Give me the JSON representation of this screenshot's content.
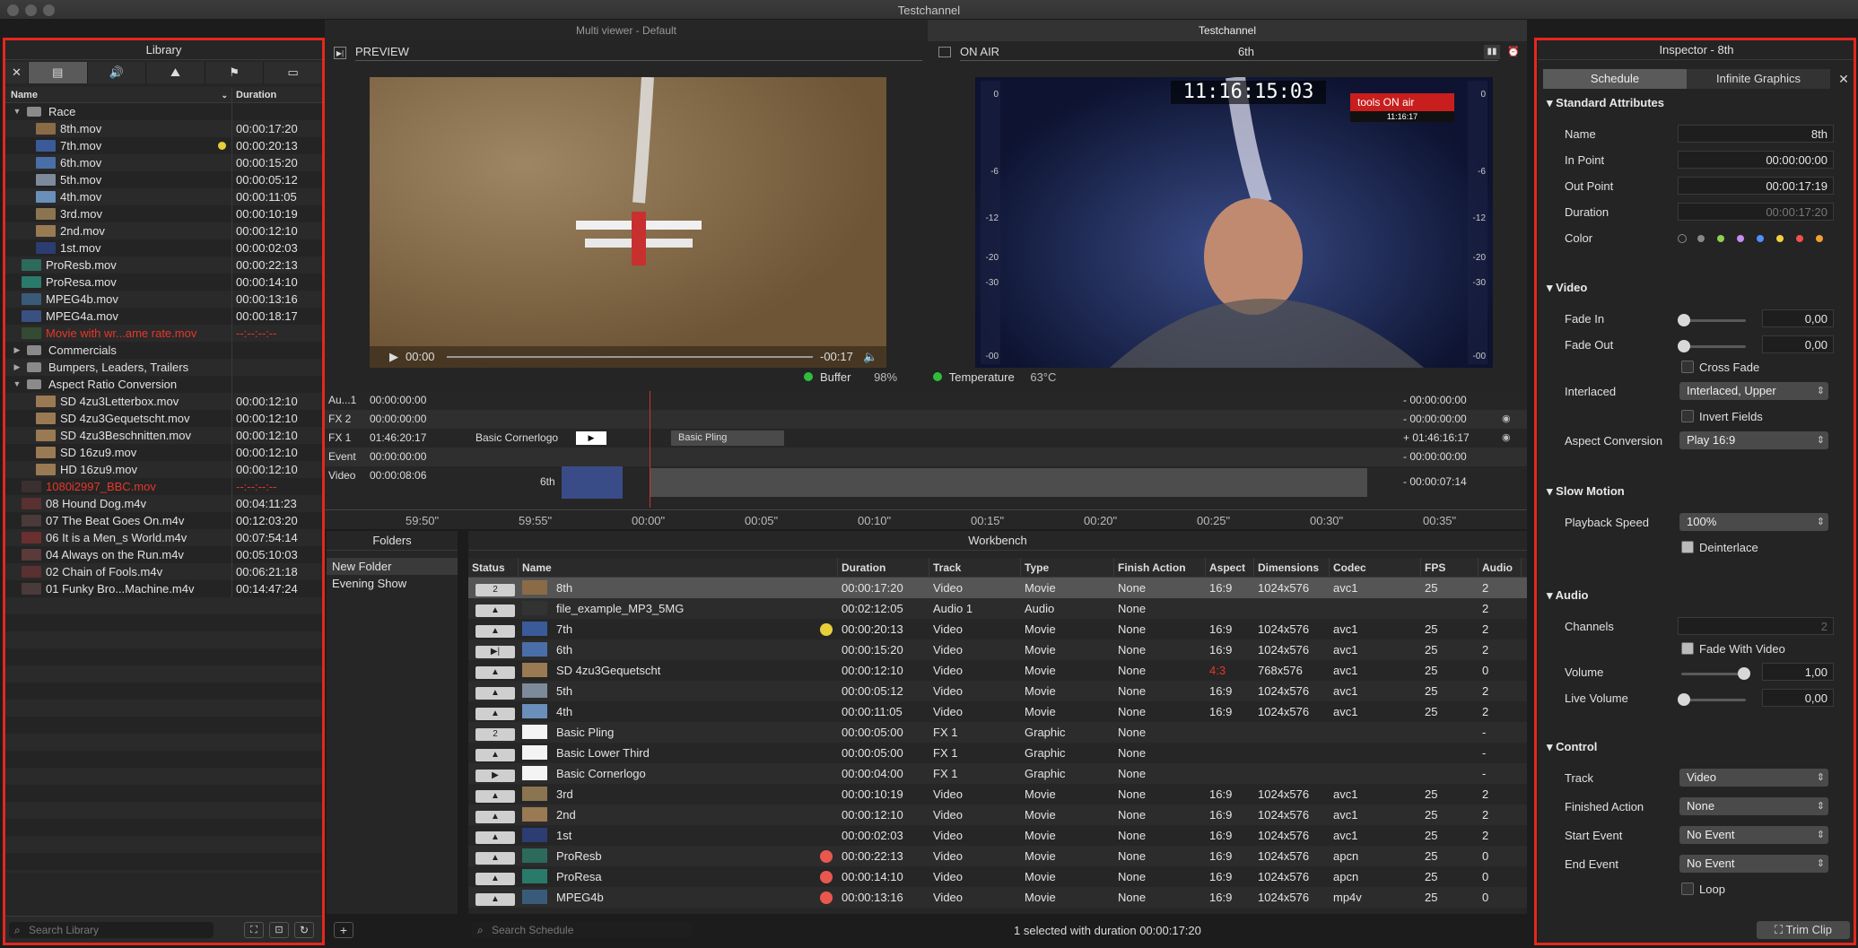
{
  "window": {
    "title": "Testchannel"
  },
  "tabs": [
    {
      "label": "Multi viewer - Default"
    },
    {
      "label": "Testchannel"
    }
  ],
  "library": {
    "title": "Library",
    "filters": [
      "✕",
      "▤",
      "🔊",
      "⛰",
      "⚑",
      "▭"
    ],
    "col_name": "Name",
    "col_duration": "Duration",
    "items": [
      {
        "name": "Race",
        "duration": "",
        "kind": "folder",
        "open": true,
        "indent": 0
      },
      {
        "name": "8th.mov",
        "duration": "00:00:17:20",
        "indent": 1,
        "thumb": "#8a6b45"
      },
      {
        "name": "7th.mov",
        "duration": "00:00:20:13",
        "indent": 1,
        "thumb": "#3b5a9a",
        "dot": true
      },
      {
        "name": "6th.mov",
        "duration": "00:00:15:20",
        "indent": 1,
        "thumb": "#4a6fa8"
      },
      {
        "name": "5th.mov",
        "duration": "00:00:05:12",
        "indent": 1,
        "thumb": "#7d8a9a"
      },
      {
        "name": "4th.mov",
        "duration": "00:00:11:05",
        "indent": 1,
        "thumb": "#6a8fba"
      },
      {
        "name": "3rd.mov",
        "duration": "00:00:10:19",
        "indent": 1,
        "thumb": "#8b7550"
      },
      {
        "name": "2nd.mov",
        "duration": "00:00:12:10",
        "indent": 1,
        "thumb": "#9a7a52"
      },
      {
        "name": "1st.mov",
        "duration": "00:00:02:03",
        "indent": 1,
        "thumb": "#2c3d72"
      },
      {
        "name": "ProResb.mov",
        "duration": "00:00:22:13",
        "indent": 0,
        "thumb": "#2c6a5c"
      },
      {
        "name": "ProResa.mov",
        "duration": "00:00:14:10",
        "indent": 0,
        "thumb": "#2a7a6a"
      },
      {
        "name": "MPEG4b.mov",
        "duration": "00:00:13:16",
        "indent": 0,
        "thumb": "#3a5a7a"
      },
      {
        "name": "MPEG4a.mov",
        "duration": "00:00:18:17",
        "indent": 0,
        "thumb": "#3a5080"
      },
      {
        "name": "Movie with wr...ame rate.mov",
        "duration": "--:--:--:--",
        "indent": 0,
        "thumb": "#334a33",
        "red": true
      },
      {
        "name": "Commercials",
        "duration": "",
        "kind": "folder",
        "open": false,
        "indent": 0
      },
      {
        "name": "Bumpers, Leaders, Trailers",
        "duration": "",
        "kind": "folder",
        "open": false,
        "indent": 0
      },
      {
        "name": "Aspect Ratio Conversion",
        "duration": "",
        "kind": "folder",
        "open": true,
        "indent": 0
      },
      {
        "name": "SD 4zu3Letterbox.mov",
        "duration": "00:00:12:10",
        "indent": 1,
        "thumb": "#9a7a52"
      },
      {
        "name": "SD 4zu3Gequetscht.mov",
        "duration": "00:00:12:10",
        "indent": 1,
        "thumb": "#9a7a52"
      },
      {
        "name": "SD 4zu3Beschnitten.mov",
        "duration": "00:00:12:10",
        "indent": 1,
        "thumb": "#9a7a52"
      },
      {
        "name": "SD 16zu9.mov",
        "duration": "00:00:12:10",
        "indent": 1,
        "thumb": "#9a7a52"
      },
      {
        "name": "HD 16zu9.mov",
        "duration": "00:00:12:10",
        "indent": 1,
        "thumb": "#9a7a52"
      },
      {
        "name": "1080i2997_BBC.mov",
        "duration": "--:--:--:--",
        "indent": 0,
        "thumb": "#3a3030",
        "red": true
      },
      {
        "name": "08 Hound Dog.m4v",
        "duration": "00:04:11:23",
        "indent": 0,
        "thumb": "#5a3030"
      },
      {
        "name": "07 The Beat Goes On.m4v",
        "duration": "00:12:03:20",
        "indent": 0,
        "thumb": "#4a3a3a"
      },
      {
        "name": "06 It is a Men_s World.m4v",
        "duration": "00:07:54:14",
        "indent": 0,
        "thumb": "#6a3030"
      },
      {
        "name": "04 Always on the Run.m4v",
        "duration": "00:05:10:03",
        "indent": 0,
        "thumb": "#5a3a3a"
      },
      {
        "name": "02 Chain of Fools.m4v",
        "duration": "00:06:21:18",
        "indent": 0,
        "thumb": "#5a3030"
      },
      {
        "name": "01 Funky Bro...Machine.m4v",
        "duration": "00:14:47:24",
        "indent": 0,
        "thumb": "#4a3a3a"
      }
    ],
    "search_placeholder": "Search Library"
  },
  "preview": {
    "label": "PREVIEW",
    "time_start": "00:00",
    "time_end": "-00:17"
  },
  "onair": {
    "label": "ON AIR",
    "clip": "6th",
    "timecode": "11:16:15:03",
    "logo": "tools ON air",
    "logo_time": "11:16:17",
    "meter_left": [
      "0",
      "-6",
      "-12",
      "-20",
      "-30",
      "-00"
    ],
    "meter_right": [
      "0",
      "-6",
      "-12",
      "-20",
      "-30",
      "-00"
    ]
  },
  "status": {
    "buffer_label": "Buffer",
    "buffer_value": "98%",
    "temp_label": "Temperature",
    "temp_value": "63°C"
  },
  "timeline": {
    "rows": [
      {
        "track": "Au...1",
        "time": "00:00:00:00",
        "right": "- 00:00:00:00"
      },
      {
        "track": "FX 2",
        "time": "00:00:00:00",
        "right": "- 00:00:00:00"
      },
      {
        "track": "FX 1",
        "time": "01:46:20:17",
        "clip": "Basic Cornerlogo",
        "right": "+ 01:46:16:17",
        "block": "Basic Pling"
      },
      {
        "track": "Event",
        "time": "00:00:00:00",
        "right": "- 00:00:00:00"
      },
      {
        "track": "Video",
        "time": "00:00:08:06",
        "clip": "6th",
        "right": "- 00:00:07:14"
      }
    ],
    "ruler": [
      "59:50\"",
      "59:55\"",
      "00:00\"",
      "00:05\"",
      "00:10\"",
      "00:15\"",
      "00:20\"",
      "00:25\"",
      "00:30\"",
      "00:35\""
    ]
  },
  "folders": {
    "title": "Folders",
    "items": [
      "New Folder",
      "Evening Show"
    ]
  },
  "workbench": {
    "title": "Workbench",
    "columns": [
      "Status",
      "Name",
      "Duration",
      "Track",
      "Type",
      "Finish Action",
      "Aspect",
      "Dimensions",
      "Codec",
      "",
      "FPS",
      "Audio C"
    ],
    "rows": [
      {
        "status": "2",
        "name": "8th",
        "duration": "00:00:17:20",
        "track": "Video",
        "type": "Movie",
        "finish": "None",
        "aspect": "16:9",
        "dims": "1024x576",
        "codec": "avc1",
        "fps": "25",
        "audio": "2",
        "thumb": "#8a6b45",
        "sel": true
      },
      {
        "status": "▲",
        "name": "file_example_MP3_5MG",
        "duration": "00:02:12:05",
        "track": "Audio 1",
        "type": "Audio",
        "finish": "None",
        "aspect": "",
        "dims": "",
        "codec": "",
        "fps": "",
        "audio": "2",
        "thumb": "#333"
      },
      {
        "status": "▲",
        "name": "7th",
        "duration": "00:00:20:13",
        "track": "Video",
        "type": "Movie",
        "finish": "None",
        "aspect": "16:9",
        "dims": "1024x576",
        "codec": "avc1",
        "fps": "25",
        "audio": "2",
        "thumb": "#3b5a9a",
        "dot": "#e8cf3a"
      },
      {
        "status": "▶|",
        "name": "6th",
        "duration": "00:00:15:20",
        "track": "Video",
        "type": "Movie",
        "finish": "None",
        "aspect": "16:9",
        "dims": "1024x576",
        "codec": "avc1",
        "fps": "25",
        "audio": "2",
        "thumb": "#4a6fa8"
      },
      {
        "status": "▲",
        "name": "SD 4zu3Gequetscht",
        "duration": "00:00:12:10",
        "track": "Video",
        "type": "Movie",
        "finish": "None",
        "aspect": "4:3",
        "dims": "768x576",
        "codec": "avc1",
        "fps": "25",
        "audio": "0",
        "thumb": "#9a7a52",
        "aspectRed": true
      },
      {
        "status": "▲",
        "name": "5th",
        "duration": "00:00:05:12",
        "track": "Video",
        "type": "Movie",
        "finish": "None",
        "aspect": "16:9",
        "dims": "1024x576",
        "codec": "avc1",
        "fps": "25",
        "audio": "2",
        "thumb": "#7d8a9a"
      },
      {
        "status": "▲",
        "name": "4th",
        "duration": "00:00:11:05",
        "track": "Video",
        "type": "Movie",
        "finish": "None",
        "aspect": "16:9",
        "dims": "1024x576",
        "codec": "avc1",
        "fps": "25",
        "audio": "2",
        "thumb": "#6a8fba"
      },
      {
        "status": "2",
        "name": "Basic Pling",
        "duration": "00:00:05:00",
        "track": "FX 1",
        "type": "Graphic",
        "finish": "None",
        "aspect": "",
        "dims": "",
        "codec": "",
        "fps": "",
        "audio": "-",
        "thumb": "#f4f4f4"
      },
      {
        "status": "▲",
        "name": "Basic Lower Third",
        "duration": "00:00:05:00",
        "track": "FX 1",
        "type": "Graphic",
        "finish": "None",
        "aspect": "",
        "dims": "",
        "codec": "",
        "fps": "",
        "audio": "-",
        "thumb": "#f4f4f4"
      },
      {
        "status": "▶",
        "name": "Basic Cornerlogo",
        "duration": "00:00:04:00",
        "track": "FX 1",
        "type": "Graphic",
        "finish": "None",
        "aspect": "",
        "dims": "",
        "codec": "",
        "fps": "",
        "audio": "-",
        "thumb": "#f4f4f4"
      },
      {
        "status": "▲",
        "name": "3rd",
        "duration": "00:00:10:19",
        "track": "Video",
        "type": "Movie",
        "finish": "None",
        "aspect": "16:9",
        "dims": "1024x576",
        "codec": "avc1",
        "fps": "25",
        "audio": "2",
        "thumb": "#8b7550"
      },
      {
        "status": "▲",
        "name": "2nd",
        "duration": "00:00:12:10",
        "track": "Video",
        "type": "Movie",
        "finish": "None",
        "aspect": "16:9",
        "dims": "1024x576",
        "codec": "avc1",
        "fps": "25",
        "audio": "2",
        "thumb": "#9a7a52"
      },
      {
        "status": "▲",
        "name": "1st",
        "duration": "00:00:02:03",
        "track": "Video",
        "type": "Movie",
        "finish": "None",
        "aspect": "16:9",
        "dims": "1024x576",
        "codec": "avc1",
        "fps": "25",
        "audio": "2",
        "thumb": "#2c3d72"
      },
      {
        "status": "▲",
        "name": "ProResb",
        "duration": "00:00:22:13",
        "track": "Video",
        "type": "Movie",
        "finish": "None",
        "aspect": "16:9",
        "dims": "1024x576",
        "codec": "apcn",
        "fps": "25",
        "audio": "0",
        "thumb": "#2c6a5c",
        "dot": "#e8584e"
      },
      {
        "status": "▲",
        "name": "ProResa",
        "duration": "00:00:14:10",
        "track": "Video",
        "type": "Movie",
        "finish": "None",
        "aspect": "16:9",
        "dims": "1024x576",
        "codec": "apcn",
        "fps": "25",
        "audio": "0",
        "thumb": "#2a7a6a",
        "dot": "#e8584e"
      },
      {
        "status": "▲",
        "name": "MPEG4b",
        "duration": "00:00:13:16",
        "track": "Video",
        "type": "Movie",
        "finish": "None",
        "aspect": "16:9",
        "dims": "1024x576",
        "codec": "mp4v",
        "fps": "25",
        "audio": "0",
        "thumb": "#3a5a7a",
        "dot": "#e8584e"
      }
    ],
    "search_placeholder": "Search Schedule",
    "footer": "1 selected with duration 00:00:17:20"
  },
  "inspector": {
    "title": "Inspector - 8th",
    "tabs": [
      "Schedule",
      "Infinite Graphics"
    ],
    "standard": {
      "title": "Standard Attributes",
      "name_label": "Name",
      "name": "8th",
      "in_label": "In Point",
      "in": "00:00:00:00",
      "out_label": "Out Point",
      "out": "00:00:17:19",
      "dur_label": "Duration",
      "dur": "00:00:17:20",
      "color_label": "Color"
    },
    "colors": [
      "#777777",
      "#888888",
      "#8fd14f",
      "#c48ff0",
      "#4f8fff",
      "#f0d040",
      "#f05050",
      "#f0a030"
    ],
    "video": {
      "title": "Video",
      "fadein_label": "Fade In",
      "fadein": "0,00",
      "fadeout_label": "Fade Out",
      "fadeout": "0,00",
      "crossfade": "Cross Fade",
      "interlaced_label": "Interlaced",
      "interlaced": "Interlaced, Upper",
      "invert": "Invert Fields",
      "aspect_label": "Aspect Conversion",
      "aspect": "Play 16:9"
    },
    "slowmo": {
      "title": "Slow Motion",
      "speed_label": "Playback Speed",
      "speed": "100%",
      "deinterlace": "Deinterlace"
    },
    "audio": {
      "title": "Audio",
      "channels_label": "Channels",
      "channels": "2",
      "fadewith": "Fade With Video",
      "volume_label": "Volume",
      "volume": "1,00",
      "live_label": "Live Volume",
      "live": "0,00"
    },
    "control": {
      "title": "Control",
      "track_label": "Track",
      "track": "Video",
      "finished_label": "Finished Action",
      "finished": "None",
      "start_label": "Start Event",
      "start": "No Event",
      "end_label": "End Event",
      "end": "No Event",
      "loop": "Loop"
    },
    "trim": "Trim Clip"
  }
}
